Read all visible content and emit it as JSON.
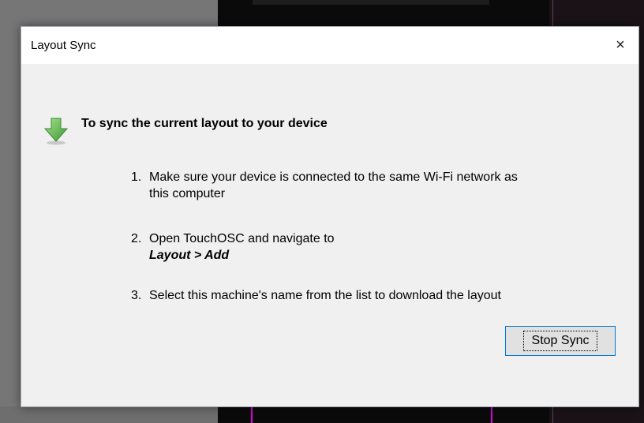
{
  "dialog": {
    "title": "Layout Sync",
    "close_label": "×",
    "heading": "To sync the current layout to your device",
    "heading_icon": "green-down-arrow-icon",
    "steps": [
      {
        "num": "1.",
        "line1": "Make sure your device is connected to the same Wi-Fi network as",
        "line2": "this computer"
      },
      {
        "num": "2.",
        "line1": "Open TouchOSC and navigate to",
        "line2": "Layout > Add"
      },
      {
        "num": "3.",
        "line1": "Select this machine's name from the list to download the layout"
      }
    ],
    "stop_button": "Stop Sync"
  },
  "colors": {
    "accent": "#0078d7",
    "arrow_green": "#5bb84a",
    "dialog_bg": "#f0f0f0"
  }
}
